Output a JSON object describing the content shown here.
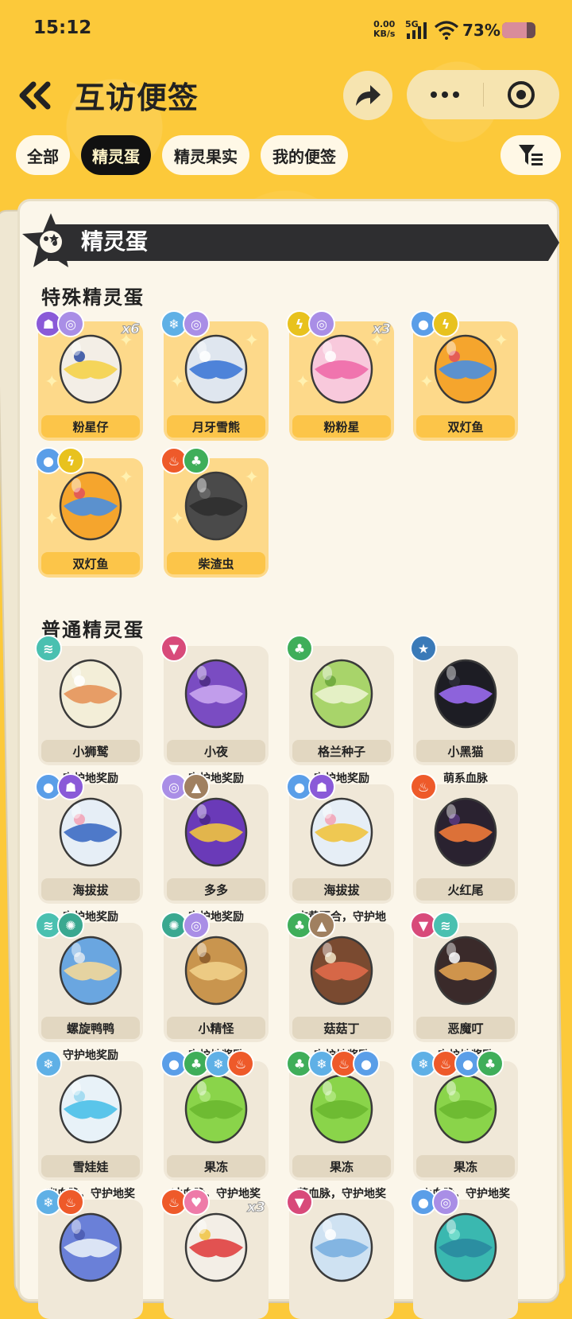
{
  "status_bar": {
    "time": "15:12",
    "net_speed_value": "0.00",
    "net_speed_unit": "KB/s",
    "network": "5G",
    "battery": "73%",
    "battery_level": 0.73
  },
  "header": {
    "title": "互访便签"
  },
  "tabs": [
    {
      "label": "全部",
      "active": false
    },
    {
      "label": "精灵蛋",
      "active": true
    },
    {
      "label": "精灵果实",
      "active": false
    },
    {
      "label": "我的便签",
      "active": false
    }
  ],
  "panel": {
    "banner_title": "精灵蛋"
  },
  "special": {
    "title": "特殊精灵蛋",
    "items": [
      {
        "name": "粉星仔",
        "count": "x6",
        "badges": [
          "ghost",
          "psychic"
        ],
        "egg": {
          "base": "#f3eee6",
          "pattern": "#f5d24a",
          "accent": "#2c4aa0"
        }
      },
      {
        "name": "月牙雪熊",
        "count": "",
        "badges": [
          "ice",
          "psychic"
        ],
        "egg": {
          "base": "#dfe6ef",
          "pattern": "#3e78d6",
          "accent": "#ffffff"
        }
      },
      {
        "name": "粉粉星",
        "count": "x3",
        "badges": [
          "electric",
          "psychic"
        ],
        "egg": {
          "base": "#f8c9dc",
          "pattern": "#ee6aa8",
          "accent": "#ffffff"
        }
      },
      {
        "name": "双灯鱼",
        "count": "",
        "badges": [
          "water",
          "electric"
        ],
        "egg": {
          "base": "#f5a52d",
          "pattern": "#4a8fe0",
          "accent": "#e0505d"
        }
      },
      {
        "name": "双灯鱼",
        "count": "",
        "badges": [
          "water",
          "electric"
        ],
        "egg": {
          "base": "#f5a52d",
          "pattern": "#4a8fe0",
          "accent": "#e0505d"
        }
      },
      {
        "name": "柴渣虫",
        "count": "",
        "badges": [
          "fire",
          "grass"
        ],
        "egg": {
          "base": "#4a4a4a",
          "pattern": "#2f2f2f",
          "accent": "#6a6a6a"
        }
      }
    ]
  },
  "normal": {
    "title": "普通精灵蛋",
    "items": [
      {
        "name": "小狮鹫",
        "sub": "守护地奖励",
        "count": "",
        "badges": [
          "wind"
        ],
        "egg": {
          "base": "#f3eed8",
          "pattern": "#e5945a",
          "accent": "#ffffff"
        }
      },
      {
        "name": "小夜",
        "sub": "守护地奖励",
        "count": "",
        "badges": [
          "demon"
        ],
        "egg": {
          "base": "#7a4cc2",
          "pattern": "#c9a6ef",
          "accent": "#4a2a80"
        }
      },
      {
        "name": "格兰种子",
        "sub": "守护地奖励",
        "count": "",
        "badges": [
          "grass"
        ],
        "egg": {
          "base": "#a8d46a",
          "pattern": "#eaf3cf",
          "accent": "#6aa63a"
        }
      },
      {
        "name": "小黑猫",
        "sub": "萌系血脉",
        "count": "",
        "badges": [
          "star"
        ],
        "egg": {
          "base": "#1d1d24",
          "pattern": "#9a6cf0",
          "accent": "#2f2f3c"
        }
      },
      {
        "name": "海拔拔",
        "sub": "守护地奖励",
        "count": "",
        "badges": [
          "water",
          "ghost"
        ],
        "egg": {
          "base": "#e6eef6",
          "pattern": "#3d6bc4",
          "accent": "#f2a0b4"
        }
      },
      {
        "name": "多多",
        "sub": "守护地奖励",
        "count": "",
        "badges": [
          "psychic",
          "rock"
        ],
        "egg": {
          "base": "#6a3ab8",
          "pattern": "#f0c340",
          "accent": "#4a2488"
        }
      },
      {
        "name": "海拔拔",
        "sub": "杏黄百合，守护地",
        "count": "",
        "badges": [
          "water",
          "ghost"
        ],
        "egg": {
          "base": "#e6eef6",
          "pattern": "#f0c340",
          "accent": "#f2a0b4"
        }
      },
      {
        "name": "火红尾",
        "sub": "",
        "count": "",
        "badges": [
          "fire"
        ],
        "egg": {
          "base": "#2a2230",
          "pattern": "#f07a3a",
          "accent": "#5a3a80"
        }
      },
      {
        "name": "螺旋鸭鸭",
        "sub": "守护地奖励",
        "count": "",
        "badges": [
          "wind",
          "mech"
        ],
        "egg": {
          "base": "#6aa6e0",
          "pattern": "#f3d89a",
          "accent": "#dfe8f0"
        }
      },
      {
        "name": "小精怪",
        "sub": "守护地奖励",
        "count": "",
        "badges": [
          "mech",
          "psychic"
        ],
        "egg": {
          "base": "#c9954e",
          "pattern": "#f0cf8a",
          "accent": "#8a5a2a"
        }
      },
      {
        "name": "菇菇丁",
        "sub": "守护地奖励",
        "count": "",
        "badges": [
          "grass",
          "rock"
        ],
        "egg": {
          "base": "#7a4a30",
          "pattern": "#e06a4a",
          "accent": "#f3e6c8"
        }
      },
      {
        "name": "恶魔叮",
        "sub": "守护地奖励",
        "count": "",
        "badges": [
          "demon",
          "wind"
        ],
        "egg": {
          "base": "#3a2a2a",
          "pattern": "#e0a050",
          "accent": "#ffffff"
        }
      },
      {
        "name": "雪娃娃",
        "sub": "幽血脉，守护地奖",
        "count": "",
        "badges": [
          "ice"
        ],
        "egg": {
          "base": "#e8f2f8",
          "pattern": "#4ac0e8",
          "accent": "#9ad8f0"
        }
      },
      {
        "name": "果冻",
        "sub": "冰血脉，守护地奖",
        "count": "",
        "badges": [
          "water",
          "grass",
          "ice",
          "fire"
        ],
        "egg": {
          "base": "#8ad44a",
          "pattern": "#6ab830",
          "accent": "#b0e880"
        }
      },
      {
        "name": "果冻",
        "sub": "草血脉，守护地奖",
        "count": "",
        "badges": [
          "grass",
          "ice",
          "fire",
          "water"
        ],
        "egg": {
          "base": "#8ad44a",
          "pattern": "#6ab830",
          "accent": "#b0e880"
        }
      },
      {
        "name": "果冻",
        "sub": "火血脉，守护地奖",
        "count": "",
        "badges": [
          "ice",
          "fire",
          "water",
          "grass"
        ],
        "egg": {
          "base": "#8ad44a",
          "pattern": "#6ab830",
          "accent": "#b0e880"
        }
      },
      {
        "name": "",
        "sub": "",
        "count": "",
        "badges": [
          "ice",
          "fire"
        ],
        "egg": {
          "base": "#6a80d8",
          "pattern": "#e8eef8",
          "accent": "#4a5ab0"
        }
      },
      {
        "name": "",
        "sub": "",
        "count": "x3",
        "badges": [
          "fire",
          "fairy"
        ],
        "egg": {
          "base": "#f3eee6",
          "pattern": "#e04040",
          "accent": "#f0c340"
        }
      },
      {
        "name": "",
        "sub": "",
        "count": "",
        "badges": [
          "demon"
        ],
        "egg": {
          "base": "#cfe2f2",
          "pattern": "#7ab0e0",
          "accent": "#ffffff"
        }
      },
      {
        "name": "",
        "sub": "",
        "count": "",
        "badges": [
          "water",
          "psychic"
        ],
        "egg": {
          "base": "#3ab8b0",
          "pattern": "#2a8aa0",
          "accent": "#7ae0d0"
        }
      }
    ]
  },
  "badge_colors": {
    "ghost": "#8a5ad8",
    "psychic": "#a98ee6",
    "ice": "#5fb0e6",
    "electric": "#e8c21e",
    "water": "#5a9ee8",
    "fire": "#ee5a2a",
    "grass": "#3fae5a",
    "wind": "#4ac0b0",
    "demon": "#d84a7a",
    "star": "#3a7ab8",
    "rock": "#a08060",
    "mech": "#3aa890",
    "fairy": "#ee7aa8"
  },
  "badge_glyphs": {
    "ghost": "☗",
    "psychic": "◎",
    "ice": "❄",
    "electric": "ϟ",
    "water": "●",
    "fire": "♨",
    "grass": "♣",
    "wind": "≋",
    "demon": "▼",
    "star": "★",
    "rock": "▲",
    "mech": "✺",
    "fairy": "♥"
  }
}
